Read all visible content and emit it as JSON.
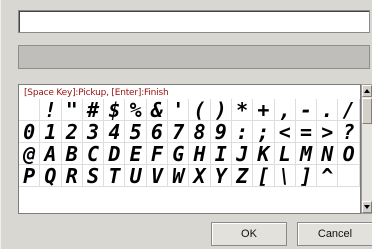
{
  "input": {
    "value": ""
  },
  "grid": {
    "hint": "[Space Key]:Pickup, [Enter]:Finish",
    "rows": [
      [
        " ",
        "!",
        "\"",
        "#",
        "$",
        "%",
        "&",
        "'",
        "(",
        ")",
        "*",
        "+",
        ",",
        "-",
        ".",
        "/"
      ],
      [
        "0",
        "1",
        "2",
        "3",
        "4",
        "5",
        "6",
        "7",
        "8",
        "9",
        ":",
        ";",
        "<",
        "=",
        ">",
        "?"
      ],
      [
        "@",
        "A",
        "B",
        "C",
        "D",
        "E",
        "F",
        "G",
        "H",
        "I",
        "J",
        "K",
        "L",
        "M",
        "N",
        "O"
      ],
      [
        "P",
        "Q",
        "R",
        "S",
        "T",
        "U",
        "V",
        "W",
        "X",
        "Y",
        "Z",
        "[",
        "\\",
        "]",
        "^",
        "_"
      ]
    ]
  },
  "buttons": {
    "ok": "OK",
    "cancel": "Cancel"
  },
  "colors": {
    "hint_text": "#9a1010",
    "dialog_bg": "#d9d7d2"
  }
}
